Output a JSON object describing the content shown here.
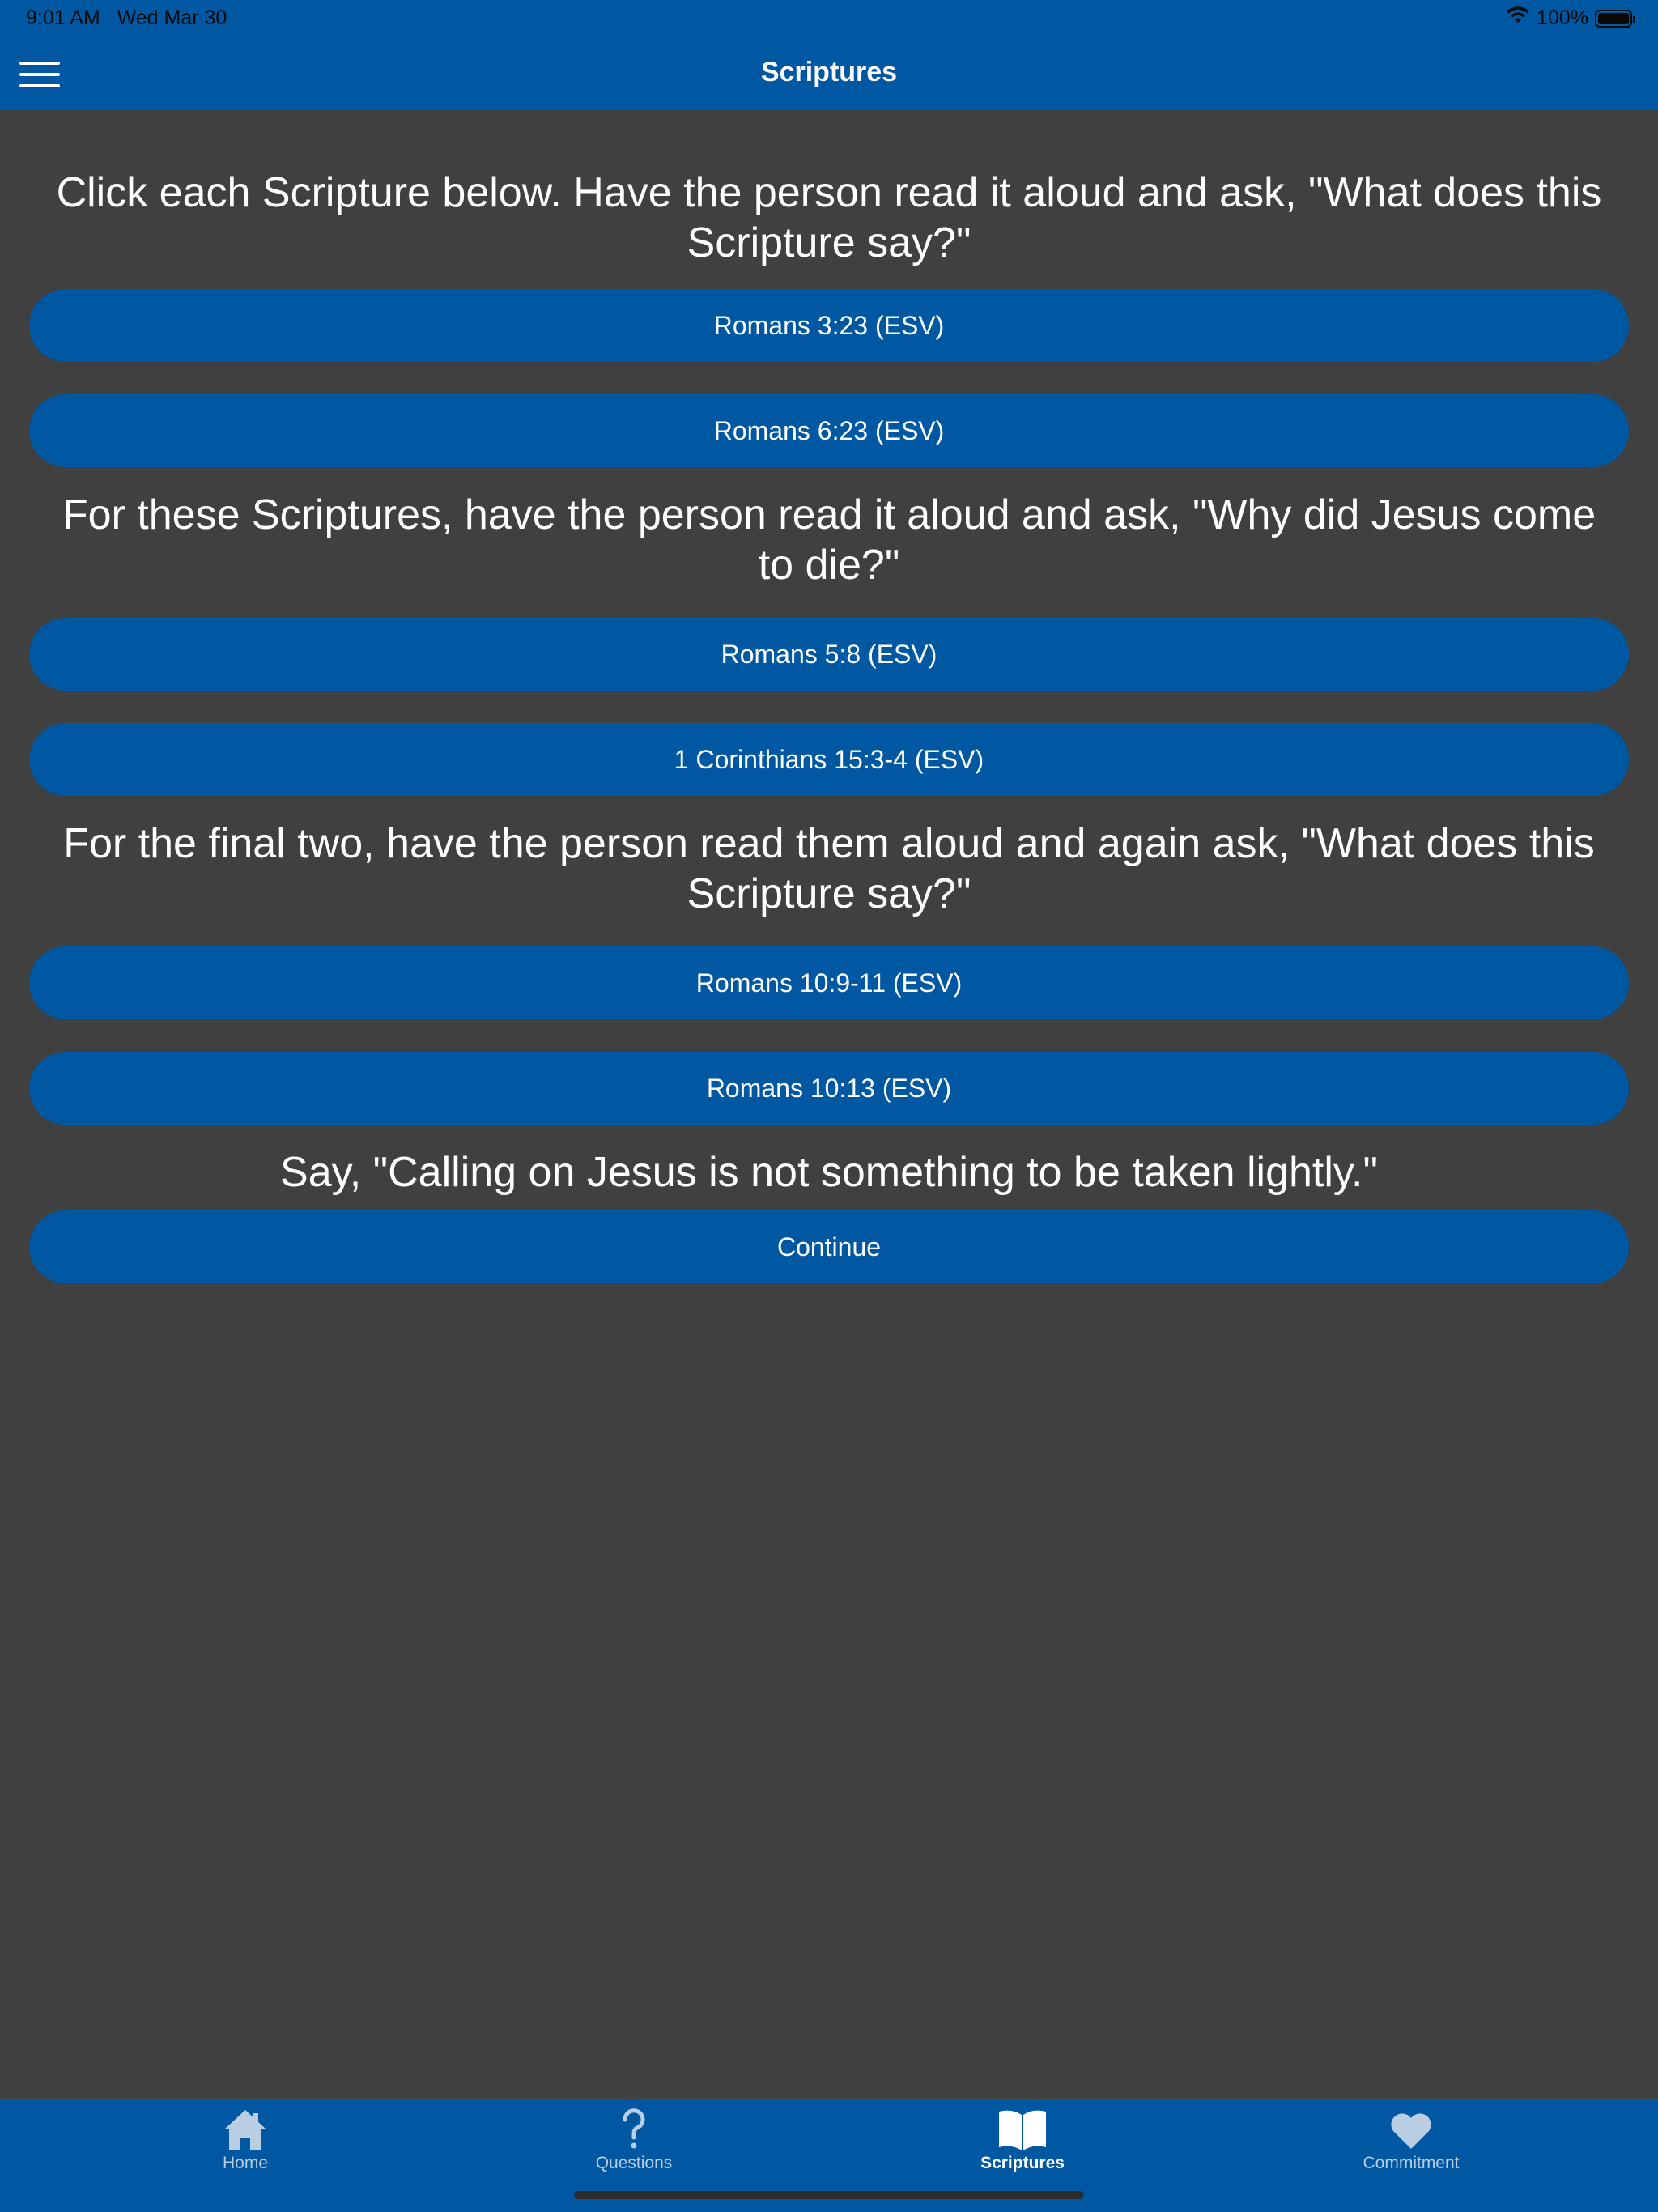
{
  "status_bar": {
    "time": "9:01 AM",
    "date": "Wed Mar 30",
    "battery": "100%"
  },
  "nav": {
    "title": "Scriptures"
  },
  "sections": [
    {
      "instruction": "Click each Scripture below. Have the person read it aloud and ask, \"What does this Scripture say?\"",
      "buttons": [
        "Romans 3:23 (ESV)",
        "Romans 6:23 (ESV)"
      ]
    },
    {
      "instruction": "For these Scriptures, have the person read it aloud and ask, \"Why did Jesus come to die?\"",
      "buttons": [
        "Romans 5:8 (ESV)",
        "1 Corinthians 15:3-4 (ESV)"
      ]
    },
    {
      "instruction": "For the final two, have the person read them aloud and again ask, \"What does this Scripture say?\"",
      "buttons": [
        "Romans 10:9-11 (ESV)",
        "Romans 10:13 (ESV)"
      ]
    },
    {
      "instruction": "Say, \"Calling on Jesus is not something to be taken lightly.\"",
      "buttons": [
        "Continue"
      ]
    }
  ],
  "tabs": [
    {
      "label": "Home",
      "icon": "home-icon"
    },
    {
      "label": "Questions",
      "icon": "question-icon"
    },
    {
      "label": "Scriptures",
      "icon": "book-icon"
    },
    {
      "label": "Commitment",
      "icon": "heart-icon"
    }
  ],
  "colors": {
    "primary": "#0058a2",
    "background": "#404040",
    "tab_inactive": "#b9cde3"
  }
}
